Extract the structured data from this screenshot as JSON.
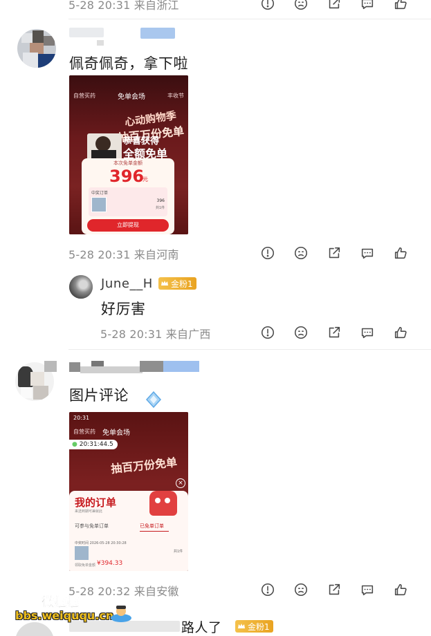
{
  "comments": [
    {
      "meta": "5-28 20:31 来自浙江"
    },
    {
      "text": "佩奇佩奇，拿下啦",
      "meta": "5-28 20:31 来自河南",
      "image": {
        "nav_left": "自营买药",
        "nav_title": "免单会场",
        "nav_right": "丰收节",
        "banner_top": "心动购物季",
        "banner_main": "抽百万份免单",
        "congrats": "恭喜获得",
        "full_free": "全额免单",
        "amount_label": "本次免单金额",
        "amount": "396",
        "amount_unit": "元",
        "order_label": "中奖订单",
        "order_price": "396",
        "order_count": "共1件",
        "cta": "立即提现"
      }
    },
    {
      "username": "June__H",
      "badge": "金粉1",
      "text": "好厉害",
      "meta": "5-28 20:31 来自广西"
    },
    {
      "text": "图片评论",
      "meta": "5-28 20:32 来自安徽",
      "image": {
        "status_time": "20:31",
        "nav_left": "自营买药",
        "nav_title": "免单会场",
        "timer": "20:31:44.5",
        "banner_main": "抽百万份免单",
        "panel_title": "我的订单",
        "panel_sub": "来选到期可兼就此",
        "tab_1": "可参与免单订单",
        "tab_2": "已免单订单",
        "order_time": "中奖时间 2026-05-28 20:30:28",
        "order_count": "共1件",
        "paid_label": "领取免单金额",
        "paid_amount": "¥394.33"
      }
    },
    {
      "text_partial": "路人了",
      "badge": "金粉1"
    }
  ],
  "watermark": {
    "line1": "微趣趣",
    "line2": "bbs.weiququ.cn"
  },
  "colors": {
    "meta": "#8a8a8a",
    "icon": "#4a4a4a",
    "badge": "#f0b23a",
    "shot_bg": "#5a1414",
    "shot_red": "#e0262b"
  },
  "action_icons": [
    "report-icon",
    "dislike-face-icon",
    "share-icon",
    "reply-icon",
    "like-icon"
  ]
}
